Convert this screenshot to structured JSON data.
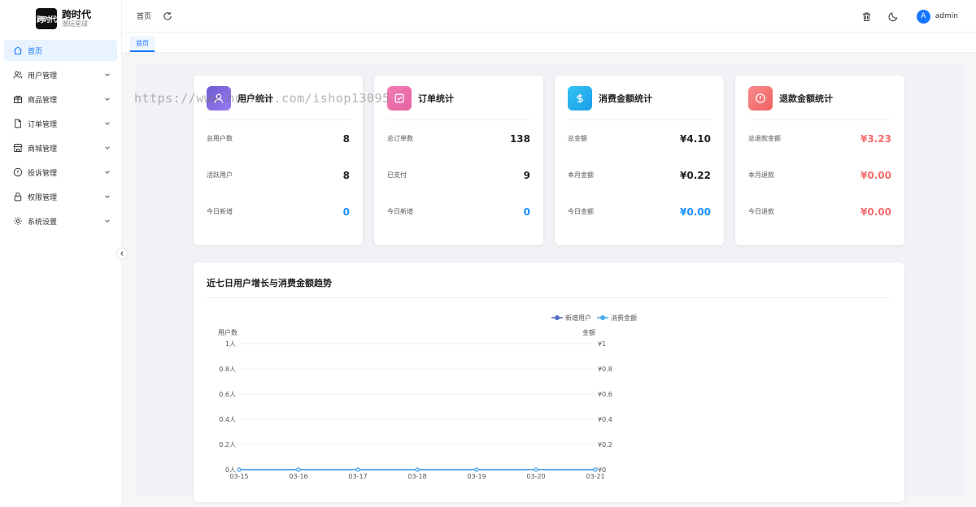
{
  "app": {
    "logo_mark": "跨时代",
    "title": "跨时代",
    "subtitle": "潮玩星球"
  },
  "sidebar": {
    "items": [
      {
        "label": "首页",
        "icon": "home-icon"
      },
      {
        "label": "用户管理",
        "icon": "users-icon"
      },
      {
        "label": "商品管理",
        "icon": "goods-icon"
      },
      {
        "label": "订单管理",
        "icon": "order-icon"
      },
      {
        "label": "商城管理",
        "icon": "shop-icon"
      },
      {
        "label": "投诉管理",
        "icon": "complaint-icon"
      },
      {
        "label": "权限管理",
        "icon": "lock-icon"
      },
      {
        "label": "系统设置",
        "icon": "gear-icon"
      }
    ]
  },
  "header": {
    "breadcrumb": "首页",
    "avatar_letter": "A",
    "username": "admin"
  },
  "tabs": [
    {
      "label": "首页"
    }
  ],
  "watermark": "https://www.huzhan.com/ishop13095",
  "cards": [
    {
      "title": "用户统计",
      "color": "#7b61d9",
      "rows": [
        {
          "label": "总用户数",
          "value": "8"
        },
        {
          "label": "活跃用户",
          "value": "8"
        },
        {
          "label": "今日新增",
          "value": "0"
        }
      ]
    },
    {
      "title": "订单统计",
      "color": "#f06fa9",
      "rows": [
        {
          "label": "总订单数",
          "value": "138"
        },
        {
          "label": "已支付",
          "value": "9"
        },
        {
          "label": "今日新增",
          "value": "0"
        }
      ]
    },
    {
      "title": "消费金额统计",
      "color": "#2fb8f0",
      "rows": [
        {
          "label": "总金额",
          "value": "¥4.10"
        },
        {
          "label": "本月金额",
          "value": "¥0.22"
        },
        {
          "label": "今日金额",
          "value": "¥0.00"
        }
      ]
    },
    {
      "title": "退款金额统计",
      "color": "#f56c6c",
      "rows": [
        {
          "label": "总退款金额",
          "value": "¥3.23"
        },
        {
          "label": "本月退款",
          "value": "¥0.00"
        },
        {
          "label": "今日退款",
          "value": "¥0.00"
        }
      ]
    }
  ],
  "chart_data": {
    "type": "line",
    "title": "近七日用户增长与消费金额趋势",
    "categories": [
      "03-15",
      "03-16",
      "03-17",
      "03-18",
      "03-19",
      "03-20",
      "03-21"
    ],
    "series": [
      {
        "name": "新增用户",
        "axis": "left",
        "color": "#5470c6",
        "values": [
          0,
          0,
          0,
          0,
          0,
          0,
          0
        ]
      },
      {
        "name": "消费金额",
        "axis": "right",
        "color": "#4aa8f0",
        "values": [
          0,
          0,
          0,
          0,
          0,
          0,
          0
        ]
      }
    ],
    "y_left": {
      "label": "用户数",
      "ticks": [
        "0人",
        "0.2人",
        "0.4人",
        "0.6人",
        "0.8人",
        "1人"
      ],
      "ylim": [
        0,
        1
      ]
    },
    "y_right": {
      "label": "金额",
      "ticks": [
        "¥0",
        "¥0.2",
        "¥0.4",
        "¥0.6",
        "¥0.8",
        "¥1"
      ],
      "ylim": [
        0,
        1
      ]
    },
    "legend": "top-center",
    "grid": true
  }
}
